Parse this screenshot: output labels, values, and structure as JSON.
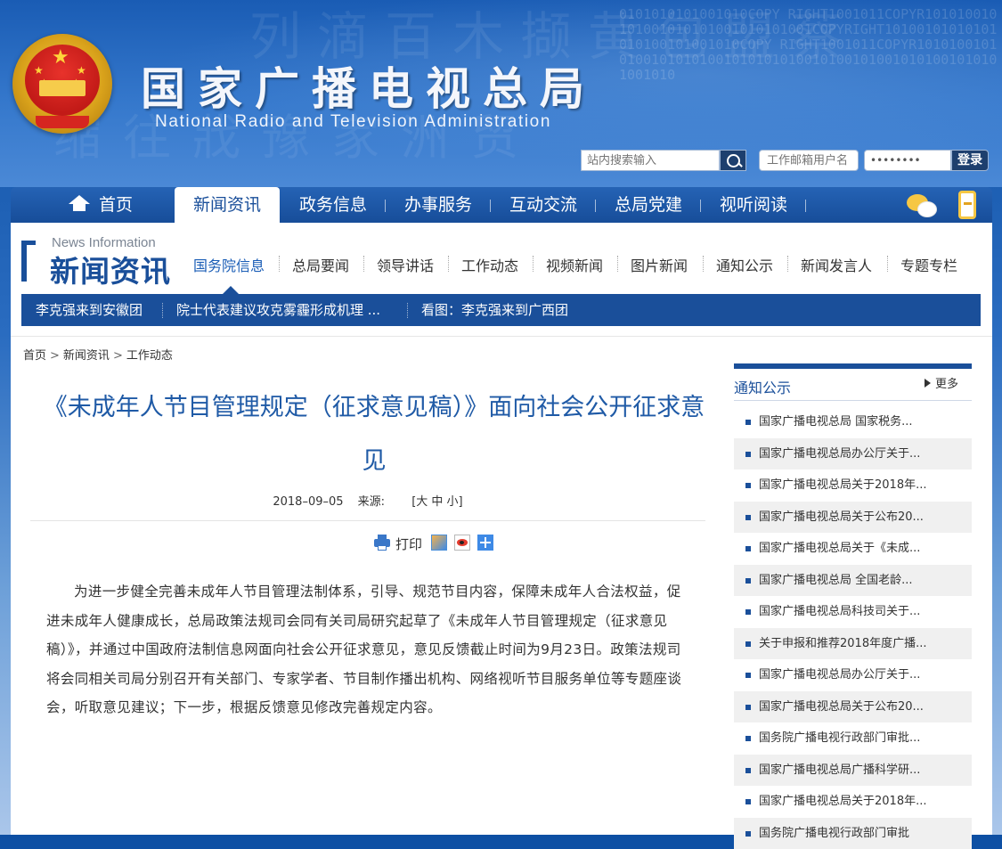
{
  "header": {
    "title": "国家广播电视总局",
    "subtitle": "National Radio and Television Administration",
    "search_placeholder": "站内搜索输入",
    "mail_user_placeholder": "工作邮箱用户名",
    "mail_password_mask": "••••••••",
    "login_label": "登录"
  },
  "nav": {
    "items": [
      {
        "label": "首页"
      },
      {
        "label": "新闻资讯"
      },
      {
        "label": "政务信息"
      },
      {
        "label": "办事服务"
      },
      {
        "label": "互动交流"
      },
      {
        "label": "总局党建"
      },
      {
        "label": "视听阅读"
      }
    ]
  },
  "section": {
    "en": "News Information",
    "cn": "新闻资讯",
    "subnav": [
      "国务院信息",
      "总局要闻",
      "领导讲话",
      "工作动态",
      "视频新闻",
      "图片新闻",
      "通知公示",
      "新闻发言人",
      "专题专栏"
    ]
  },
  "ticker": [
    "李克强来到安徽团",
    "院士代表建议攻克雾霾形成机理 ...",
    "看图：李克强来到广西团"
  ],
  "breadcrumb": [
    "首页",
    "新闻资讯",
    "工作动态"
  ],
  "article": {
    "title": "《未成年人节目管理规定（征求意见稿）》面向社会公开征求意见",
    "date": "2018–09–05",
    "source_label": "来源:",
    "font_size_label": "[大 中 小]",
    "print_label": "打印",
    "body": "为进一步健全完善未成年人节目管理法制体系，引导、规范节目内容，保障未成年人合法权益，促进未成年人健康成长，总局政策法规司会同有关司局研究起草了《未成年人节目管理规定（征求意见稿）》，并通过中国政府法制信息网面向社会公开征求意见，意见反馈截止时间为9月23日。政策法规司将会同相关司局分别召开有关部门、专家学者、节目制作播出机构、网络视听节目服务单位等专题座谈会，听取意见建议；下一步，根据反馈意见修改完善规定内容。"
  },
  "sidebar": {
    "title": "通知公示",
    "more_label": "更多",
    "items": [
      "国家广播电视总局 国家税务...",
      "国家广播电视总局办公厅关于...",
      "国家广播电视总局关于2018年...",
      "国家广播电视总局关于公布20...",
      "国家广播电视总局关于《未成...",
      "国家广播电视总局 全国老龄...",
      "国家广播电视总局科技司关于...",
      "关于申报和推荐2018年度广播...",
      "国家广播电视总局办公厅关于...",
      "国家广播电视总局关于公布20...",
      "国务院广播电视行政部门审批...",
      "国家广播电视总局广播科学研...",
      "国家广播电视总局关于2018年...",
      "国务院广播电视行政部门审批"
    ]
  },
  "colors": {
    "brand_blue": "#1a4f9a",
    "link_blue": "#1f5aa6",
    "accent_yellow": "#f6c744"
  },
  "icons": [
    "national-emblem-icon",
    "search-icon",
    "home-icon",
    "wechat-icon",
    "mobile-icon",
    "print-icon",
    "share-qzone-icon",
    "share-weibo-icon",
    "share-more-icon"
  ]
}
